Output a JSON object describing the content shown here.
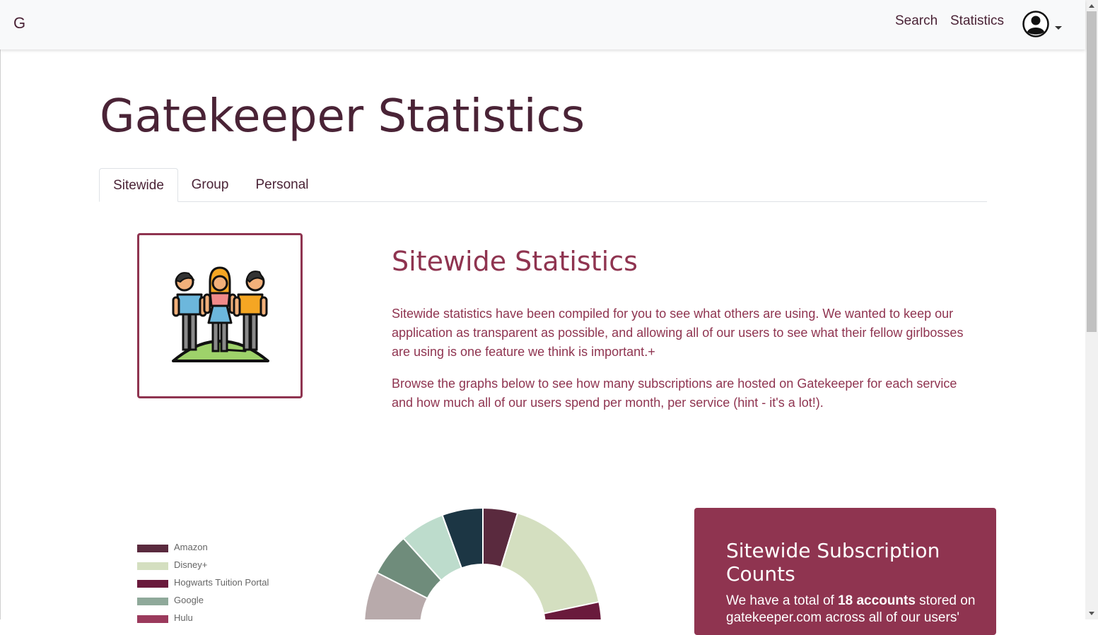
{
  "navbar": {
    "brand": "G",
    "links": [
      {
        "label": "Search"
      },
      {
        "label": "Statistics"
      }
    ],
    "user_menu_icon": "user-circle-icon"
  },
  "page": {
    "title": "Gatekeeper Statistics"
  },
  "tabs": [
    {
      "label": "Sitewide",
      "active": true
    },
    {
      "label": "Group",
      "active": false
    },
    {
      "label": "Personal",
      "active": false
    }
  ],
  "sitewide": {
    "illustration": "people-on-hill-icon",
    "heading": "Sitewide Statistics",
    "paragraph1": "Sitewide statistics have been compiled for you to see what others are using. We wanted to keep our application as transparent as possible, and allowing all of our users to see what their fellow girlbosses are using is one feature we think is important.+",
    "paragraph2": "Browse the graphs below to see how many subscriptions are hosted on Gatekeeper for each service and how much all of our users spend per month, per service (hint - it's a lot!)."
  },
  "chart_data": {
    "type": "pie",
    "variant": "doughnut",
    "legend_position": "left",
    "series": [
      {
        "label": "Amazon",
        "color": "#5a2a3e"
      },
      {
        "label": "Disney+",
        "color": "#d4dfc0"
      },
      {
        "label": "Hogwarts Tuition Portal",
        "color": "#6a1a3c"
      },
      {
        "label": "Google",
        "color": "#8fa99a"
      },
      {
        "label": "Hulu",
        "color": "#9b3a5c"
      }
    ],
    "unlabeled_visible_slices_colors": [
      "#1c3644",
      "#bddccc",
      "#6f8c7b",
      "#b8aaab",
      "#3d5f6c"
    ]
  },
  "stats_card": {
    "title": "Sitewide Subscription Counts",
    "text_prefix": "We have a total of ",
    "text_bold": "18 accounts",
    "text_suffix": " stored on",
    "text_line2": "gatekeeper.com across all of our users'"
  },
  "colors": {
    "brand_dark": "#4a2336",
    "accent": "#8f3450",
    "navbar_bg": "#f8f9fa"
  }
}
